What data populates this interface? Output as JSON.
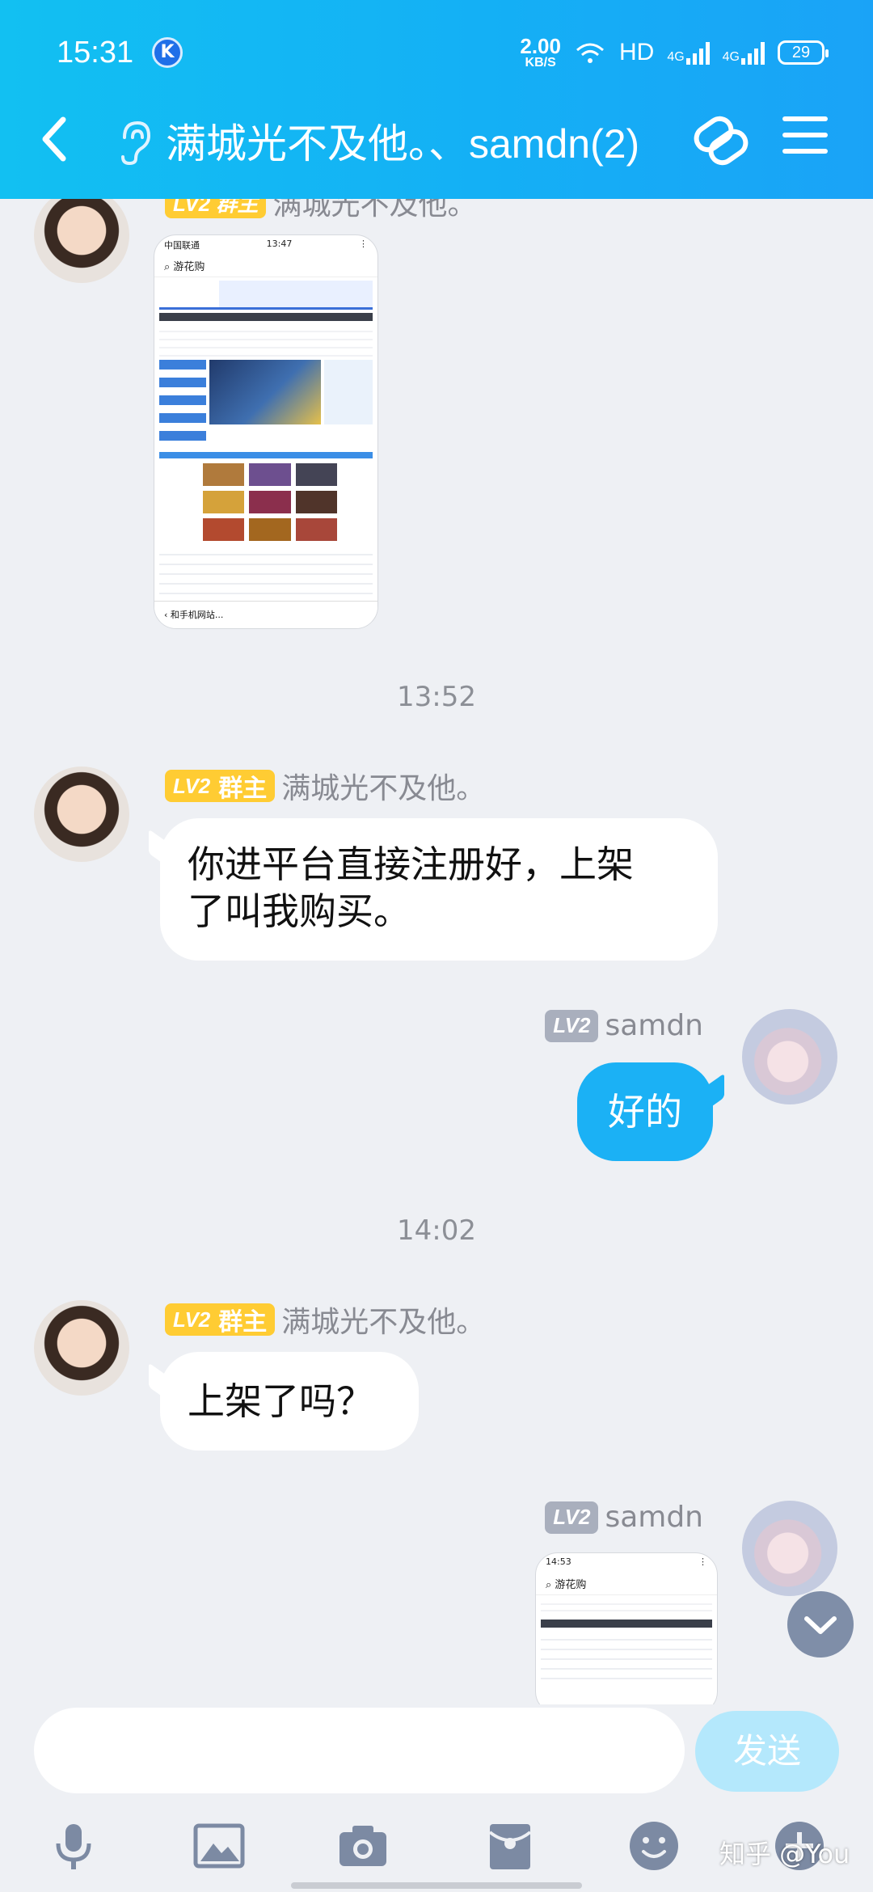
{
  "status_bar": {
    "time": "15:31",
    "k_icon_label": "K",
    "net_speed": "2.00",
    "net_unit": "KB/S",
    "hd_label": "HD",
    "sim_label": "4G",
    "sim2_label": "4G",
    "battery": "29"
  },
  "header": {
    "title": "满城光不及他。、samdn(2)"
  },
  "messages": {
    "partial_name": "满城光不及他。",
    "partial_badge": "LV2 群主",
    "ts1": "13:52",
    "m1_badge_lv": "LV2",
    "m1_badge_role": "群主",
    "m1_sender": "满城光不及他。",
    "m1_text_line1": "你进平台直接注册好，上架",
    "m1_text_line2": "了叫我购买。",
    "m2_badge_lv": "LV2",
    "m2_sender": "samdn",
    "m2_text": "好的",
    "ts2": "14:02",
    "m3_badge_lv": "LV2",
    "m3_badge_role": "群主",
    "m3_sender": "满城光不及他。",
    "m3_text": "上架了吗？",
    "m4_badge_lv": "LV2",
    "m4_sender": "samdn"
  },
  "screenshot_1": {
    "carrier": "中国联通",
    "time": "13:47",
    "search": "游花购",
    "bottom_input": "和手机网站..."
  },
  "screenshot_2": {
    "time": "14:53",
    "search": "游花购"
  },
  "input": {
    "placeholder": "",
    "send_label": "发送"
  },
  "watermark": "知乎 @You",
  "colors": {
    "header_blue": "#14b0f5",
    "my_bubble": "#1bb1f5",
    "badge_gold": "#ffcc33",
    "badge_grey": "#a9afbd",
    "background": "#eef0f4"
  }
}
